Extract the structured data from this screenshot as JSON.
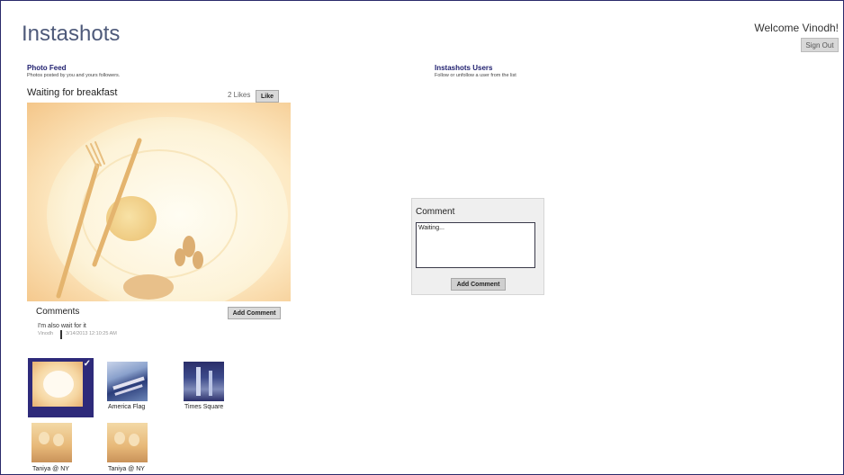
{
  "app": {
    "title": "Instashots"
  },
  "header": {
    "welcome": "Welcome Vinodh!",
    "sign_out_label": "Sign Out"
  },
  "photo_feed": {
    "title": "Photo Feed",
    "subtitle": "Photos posted by you and yours followers.",
    "post": {
      "title": "Waiting for breakfast",
      "likes_text": "2 Likes",
      "like_label": "Like"
    },
    "comments": {
      "title": "Comments",
      "add_label": "Add Comment",
      "items": [
        {
          "text": "I'm also wait for it",
          "author": "Vinodh",
          "timestamp": "3/14/2013 12:10:25 AM"
        }
      ]
    },
    "thumbnails": [
      {
        "label": "",
        "selected": true
      },
      {
        "label": "America Flag",
        "selected": false
      },
      {
        "label": "Times Square",
        "selected": false
      },
      {
        "label": "Taniya @ NY",
        "selected": false
      },
      {
        "label": "Taniya @ NY",
        "selected": false
      }
    ]
  },
  "users_panel": {
    "title": "Instashots Users",
    "subtitle": "Follow or unfollow a user from the list"
  },
  "comment_dialog": {
    "title": "Comment",
    "input_value": "Waiting...",
    "submit_label": "Add Comment"
  },
  "colors": {
    "accent": "#2e2a7a",
    "button_bg": "#d9d9d9",
    "dialog_bg": "#efefef",
    "title_color": "#4e5a7a"
  },
  "icons": {
    "selected_check": "check-icon"
  }
}
